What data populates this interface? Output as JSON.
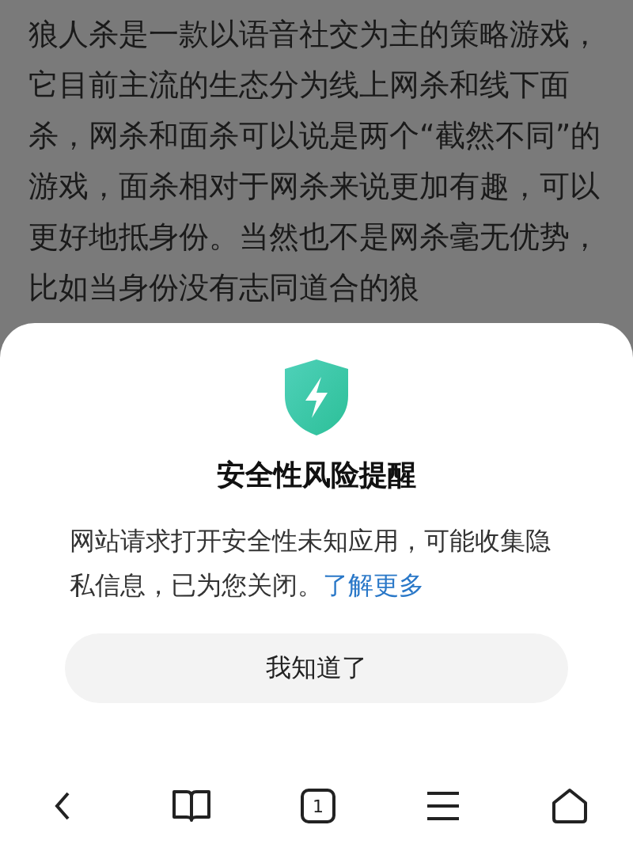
{
  "article": {
    "text": "狼人杀是一款以语音社交为主的策略游戏，它目前主流的生态分为线上网杀和线下面杀，网杀和面杀可以说是两个“截然不同”的游戏，面杀相对于网杀来说更加有趣，可以更好地抵身份。当然也不是网杀毫无优势，比如当身份没有志同道合的狼"
  },
  "dialog": {
    "title": "安全性风险提醒",
    "message": "网站请求打开安全性未知应用，可能收集隐私信息，已为您关闭。",
    "link": "了解更多",
    "button": "我知道了"
  },
  "bottom_bar": {
    "tab_count": "1"
  }
}
